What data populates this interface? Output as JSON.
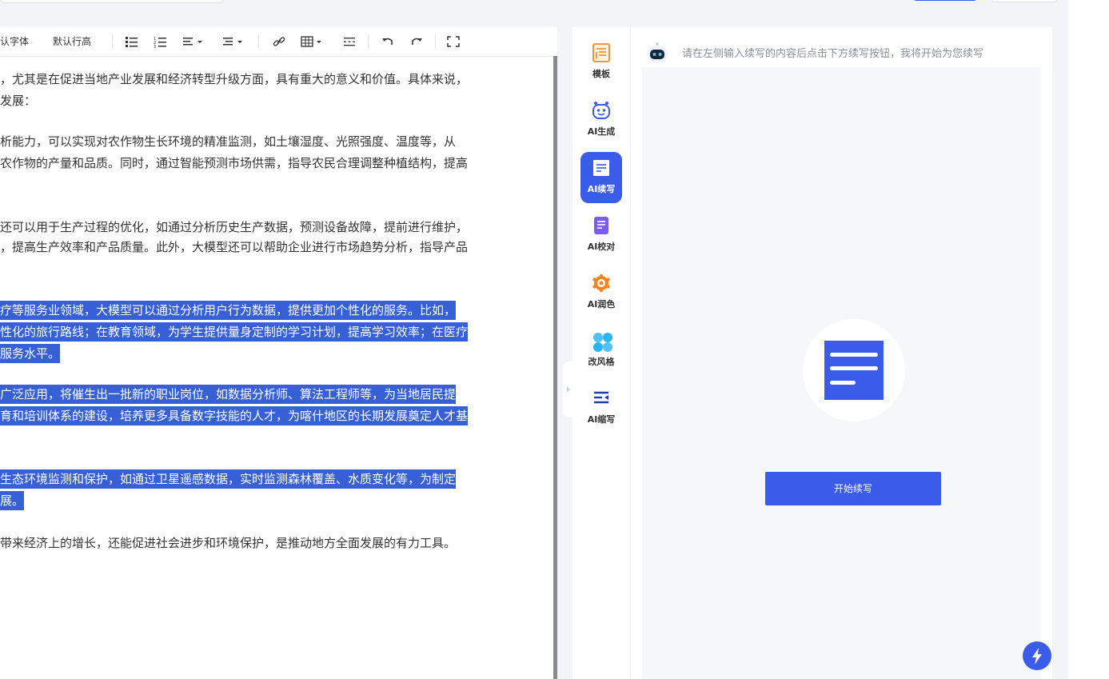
{
  "toolbar": {
    "font_label": "认字体",
    "line_height_label": "默认行高"
  },
  "editor": {
    "lines": [
      {
        "text": "，尤其是在促进当地产业发展和经济转型升级方面，具有重大的意义和价值。具体来说，",
        "highlight": false
      },
      {
        "text": "发展：",
        "highlight": false
      },
      {
        "text": "析能力，可以实现对农作物生长环境的精准监测，如土壤湿度、光照强度、温度等，从",
        "highlight": false
      },
      {
        "text": "农作物的产量和品质。同时，通过智能预测市场供需，指导农民合理调整种植结构，提高",
        "highlight": false
      },
      {
        "text": "还可以用于生产过程的优化，如通过分析历史生产数据，预测设备故障，提前进行维护，",
        "highlight": false
      },
      {
        "text": "，提高生产效率和产品质量。此外，大模型还可以帮助企业进行市场趋势分析，指导产品",
        "highlight": false
      },
      {
        "text": "疗等服务业领域，大模型可以通过分析用户行为数据，提供更加个性化的服务。比如，",
        "highlight": true
      },
      {
        "text": "性化的旅行路线；在教育领域，为学生提供量身定制的学习计划，提高学习效率；在医疗",
        "highlight": true
      },
      {
        "text": "服务水平。",
        "highlight": true
      },
      {
        "text": "广泛应用，将催生出一批新的职业岗位，如数据分析师、算法工程师等，为当地居民提",
        "highlight": true
      },
      {
        "text": "育和培训体系的建设，培养更多具备数字技能的人才，为喀什地区的长期发展奠定人才基",
        "highlight": true
      },
      {
        "text": "生态环境监测和保护，如通过卫星遥感数据，实时监测森林覆盖、水质变化等，为制定",
        "highlight": true
      },
      {
        "text": "展。",
        "highlight": true
      },
      {
        "text": "带来经济上的增长，还能促进社会进步和环境保护，是推动地方全面发展的有力工具。",
        "highlight": false
      }
    ]
  },
  "sidebar": {
    "items": [
      {
        "label": "模板",
        "icon": "template-icon",
        "active": false
      },
      {
        "label": "AI生成",
        "icon": "robot-icon",
        "active": false
      },
      {
        "label": "AI续写",
        "icon": "document-icon",
        "active": true
      },
      {
        "label": "AI校对",
        "icon": "proofread-icon",
        "active": false
      },
      {
        "label": "AI润色",
        "icon": "polish-icon",
        "active": false
      },
      {
        "label": "改风格",
        "icon": "style-icon",
        "active": false
      },
      {
        "label": "AI缩写",
        "icon": "abbreviate-icon",
        "active": false
      }
    ]
  },
  "panel": {
    "hint": "请在左侧输入续写的内容后点击下方续写按钮，我将开始为您续写",
    "start_button": "开始续写"
  },
  "colors": {
    "accent": "#3b5ce8",
    "highlight": "#3760d6"
  }
}
